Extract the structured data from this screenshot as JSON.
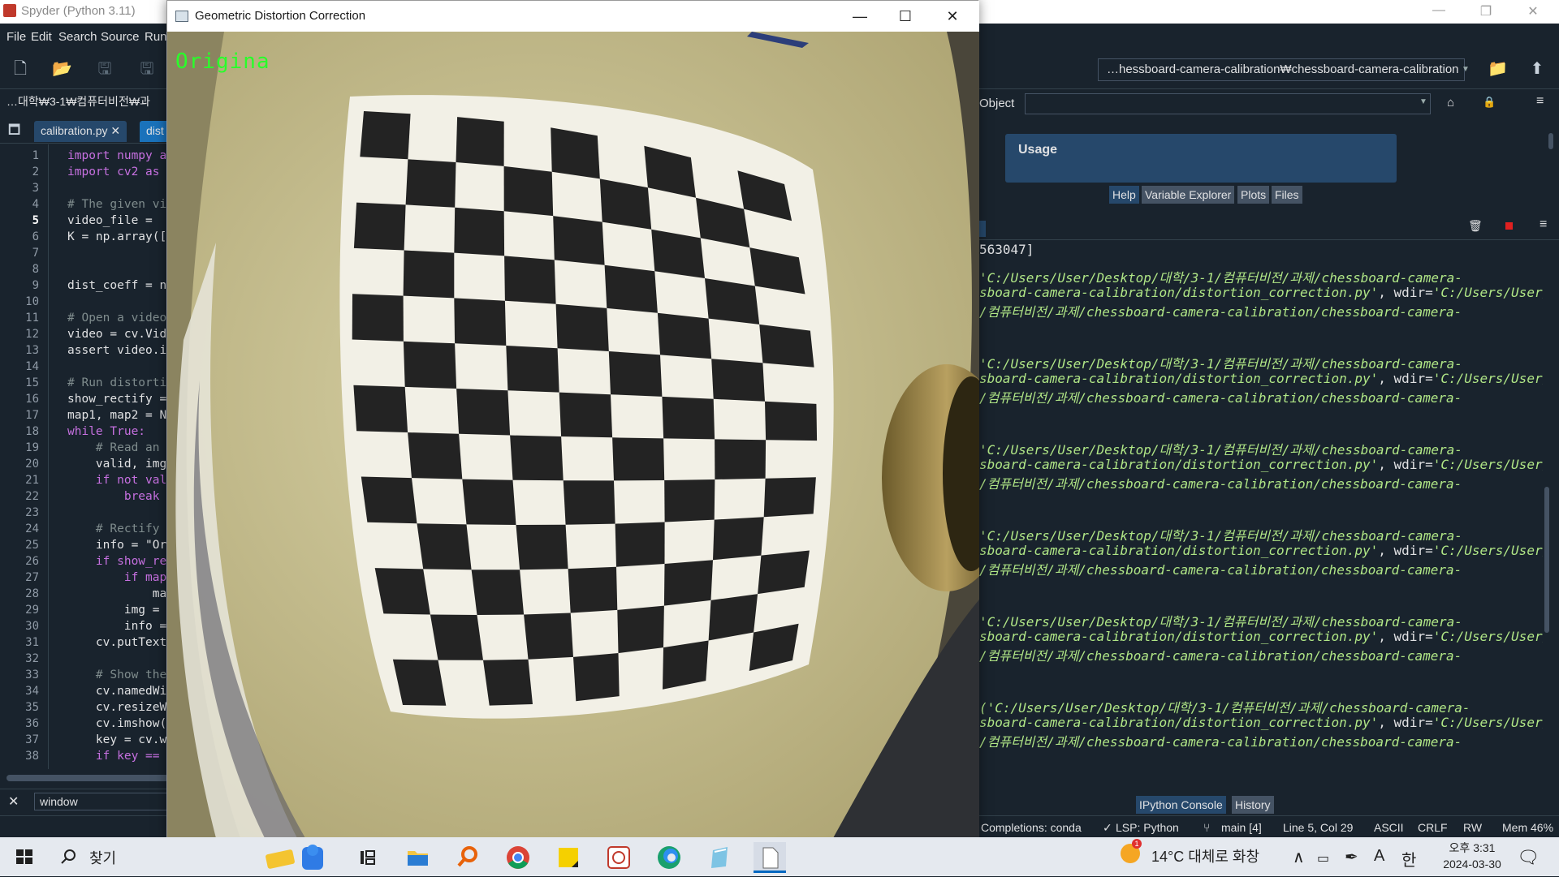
{
  "spyder": {
    "title": "Spyder (Python 3.11)",
    "menu": [
      "File",
      "Edit",
      "Search",
      "Source",
      "Run"
    ],
    "path": "…hessboard-camera-calibration₩chessboard-camera-calibration",
    "breadcrumb": "…대학₩3-1₩컴퓨터비전₩과",
    "tabs": {
      "file1": "calibration.py",
      "file2": "dist"
    },
    "object_label": "Object",
    "usage_title": "Usage",
    "help_tabs": [
      "Help",
      "Variable Explorer",
      "Plots",
      "Files"
    ],
    "console_tabs": [
      "IPython Console",
      "History"
    ],
    "find_value": "window",
    "colors": {
      "bg": "#19232d",
      "accent": "#26486b",
      "string": "#b0e686"
    }
  },
  "editor": {
    "line_numbers": [
      "1",
      "2",
      "3",
      "4",
      "5",
      "6",
      "7",
      "8",
      "9",
      "10",
      "11",
      "12",
      "13",
      "14",
      "15",
      "16",
      "17",
      "18",
      "19",
      "20",
      "21",
      "22",
      "23",
      "24",
      "25",
      "26",
      "27",
      "28",
      "29",
      "30",
      "31",
      "32",
      "33",
      "34",
      "35",
      "36",
      "37",
      "38"
    ],
    "current_line": "5",
    "lines": [
      "import numpy a",
      "import cv2 as",
      "",
      "# The given vi",
      "video_file =",
      "K = np.array([",
      "",
      "",
      "dist_coeff = n",
      "",
      "# Open a video",
      "video = cv.Vid",
      "assert video.i",
      "",
      "# Run distorti",
      "show_rectify =",
      "map1, map2 = N",
      "while True:",
      "    # Read an",
      "    valid, img",
      "    if not val",
      "        break",
      "",
      "    # Rectify",
      "    info = \"Or",
      "    if show_re",
      "        if map",
      "            ma",
      "        img =",
      "        info =",
      "    cv.putText",
      "",
      "    # Show the",
      "    cv.namedWi",
      "    cv.resizeW",
      "    cv.imshow(",
      "    key = cv.w",
      "    if key =="
    ]
  },
  "console": {
    "partial_line": "563047]",
    "blocks": [
      {
        "l1": "'C:/Users/User/Desktop/대학/3-1/컴퓨터비전/과제/chessboard-camera-",
        "l2a": "sboard-camera-calibration/distortion_correction.py'",
        "l2b": ", wdir=",
        "l2c": "'C:/Users/User/",
        "l3": "/컴퓨터비전/과제/chessboard-camera-calibration/chessboard-camera-"
      },
      {
        "l1": "'C:/Users/User/Desktop/대학/3-1/컴퓨터비전/과제/chessboard-camera-",
        "l2a": "sboard-camera-calibration/distortion_correction.py'",
        "l2b": ", wdir=",
        "l2c": "'C:/Users/User/",
        "l3": "/컴퓨터비전/과제/chessboard-camera-calibration/chessboard-camera-"
      },
      {
        "l1": "'C:/Users/User/Desktop/대학/3-1/컴퓨터비전/과제/chessboard-camera-",
        "l2a": "sboard-camera-calibration/distortion_correction.py'",
        "l2b": ", wdir=",
        "l2c": "'C:/Users/User/",
        "l3": "/컴퓨터비전/과제/chessboard-camera-calibration/chessboard-camera-"
      },
      {
        "l1": "'C:/Users/User/Desktop/대학/3-1/컴퓨터비전/과제/chessboard-camera-",
        "l2a": "sboard-camera-calibration/distortion_correction.py'",
        "l2b": ", wdir=",
        "l2c": "'C:/Users/User/",
        "l3": "/컴퓨터비전/과제/chessboard-camera-calibration/chessboard-camera-"
      },
      {
        "l1": "'C:/Users/User/Desktop/대학/3-1/컴퓨터비전/과제/chessboard-camera-",
        "l2a": "sboard-camera-calibration/distortion_correction.py'",
        "l2b": ", wdir=",
        "l2c": "'C:/Users/User/",
        "l3": "/컴퓨터비전/과제/chessboard-camera-calibration/chessboard-camera-"
      },
      {
        "l1": "('C:/Users/User/Desktop/대학/3-1/컴퓨터비전/과제/chessboard-camera-",
        "l2a": "sboard-camera-calibration/distortion_correction.py'",
        "l2b": ", wdir=",
        "l2c": "'C:/Users/User/",
        "l3": "/컴퓨터비전/과제/chessboard-camera-calibration/chessboard-camera-"
      }
    ]
  },
  "status": {
    "completions": "Completions: conda",
    "lsp": "LSP: Python",
    "branch": "main [4]",
    "position": "Line 5, Col 29",
    "encoding": "ASCII",
    "eol": "CRLF",
    "rw": "RW",
    "mem": "Mem 46%"
  },
  "cv_window": {
    "title": "Geometric Distortion Correction",
    "overlay_text": "Origina"
  },
  "taskbar": {
    "search_placeholder": "찾기",
    "weather": "14°C 대체로 화창",
    "time": "오후 3:31",
    "date": "2024-03-30",
    "ime_a": "A",
    "ime_han": "한"
  }
}
